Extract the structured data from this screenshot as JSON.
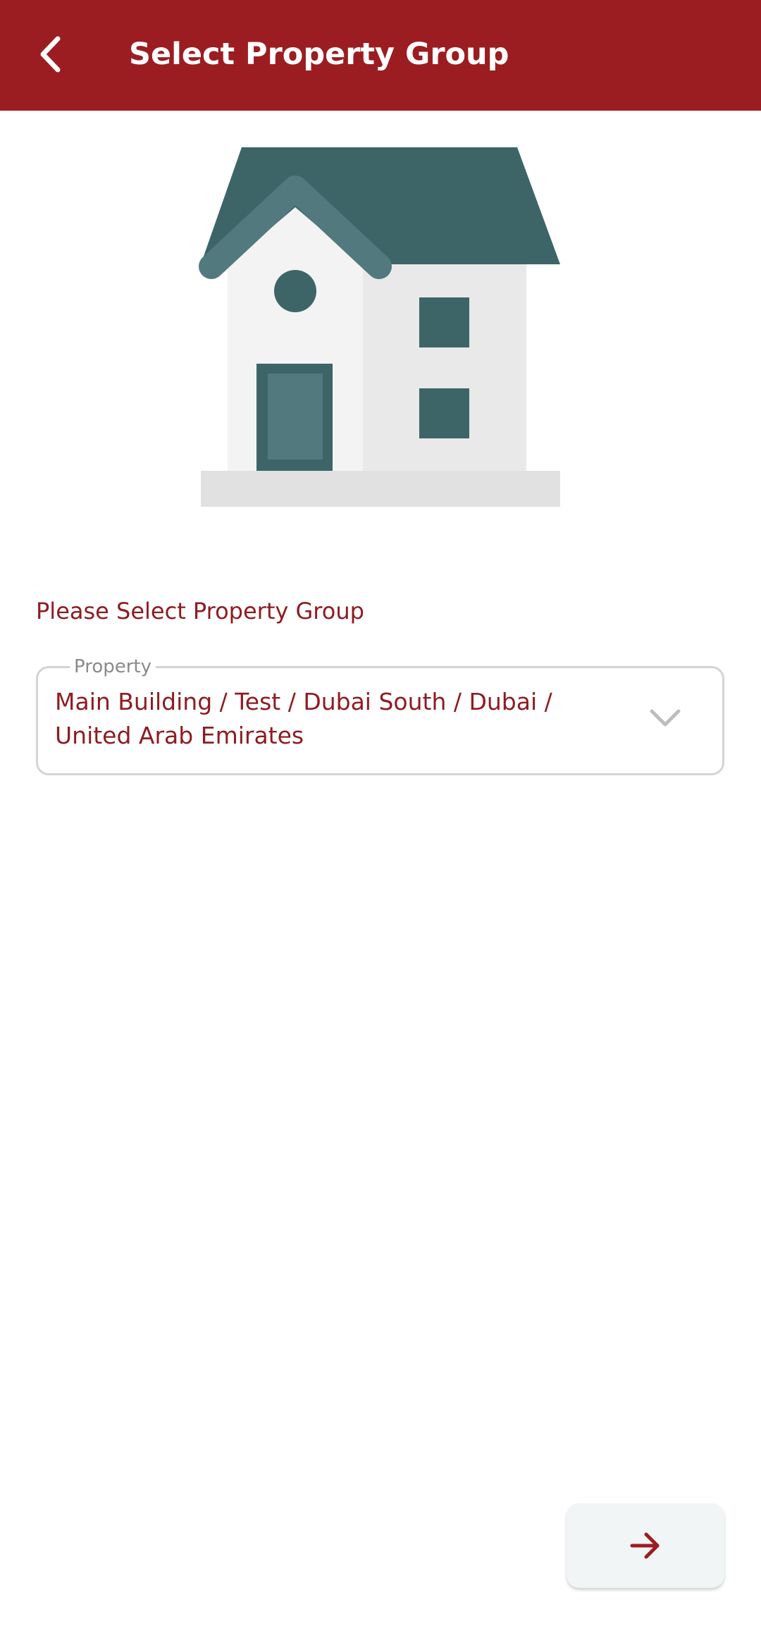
{
  "app_bar": {
    "title": "Select Property Group",
    "back_icon": "chevron-left-icon",
    "background_color": "#9B1D22"
  },
  "illustration": {
    "icon": "house-icon"
  },
  "form": {
    "prompt": "Please Select Property Group",
    "property_field": {
      "label": "Property",
      "value_line1": "Main Building / Test / Dubai South / Dubai /",
      "value_line2": "United Arab Emirates",
      "dropdown_icon": "chevron-down-icon"
    }
  },
  "next_button": {
    "icon": "arrow-right-icon"
  },
  "colors": {
    "accent": "#9B1D22",
    "text_accent": "#8E1C21",
    "house_dark": "#3D6568",
    "house_light": "#527A7E"
  }
}
